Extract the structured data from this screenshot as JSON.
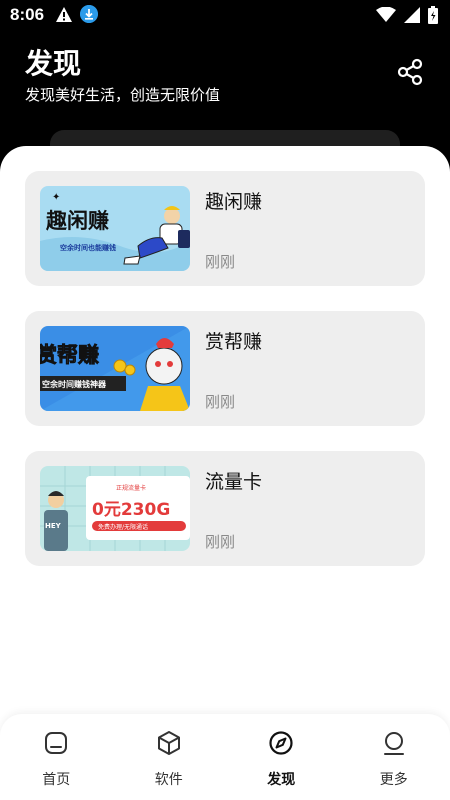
{
  "status_bar": {
    "time": "8:06",
    "icons": [
      "warning-icon",
      "download-icon",
      "wifi-icon",
      "cell-signal-icon",
      "battery-icon"
    ]
  },
  "header": {
    "title": "发现",
    "subtitle": "发现美好生活，创造无限价值",
    "share_icon": "share-icon"
  },
  "cards": [
    {
      "title": "趣闲赚",
      "time": "刚刚",
      "thumb": {
        "headline": "趣闲赚",
        "sub": "空余时间也能赚钱",
        "bg": "#a9dcf2"
      }
    },
    {
      "title": "赏帮赚",
      "time": "刚刚",
      "thumb": {
        "headline": "赏帮赚",
        "sub": "空余时间赚钱神器",
        "bg": "#3a8ee6"
      }
    },
    {
      "title": "流量卡",
      "time": "刚刚",
      "thumb": {
        "headline": "0元230G",
        "tag": "正规流量卡",
        "sub": "免费办理/无限通话",
        "bg": "#bfe7e6"
      }
    }
  ],
  "tabbar": {
    "active": 2,
    "tabs": [
      {
        "label": "首页",
        "icon": "home-icon"
      },
      {
        "label": "软件",
        "icon": "cube-icon"
      },
      {
        "label": "发现",
        "icon": "compass-icon"
      },
      {
        "label": "更多",
        "icon": "user-icon"
      }
    ]
  },
  "colors": {
    "header_bg": "#000000",
    "card_bg": "#eeeeee",
    "time_text": "#8a8a8a",
    "thumb_red": "#e33b3b"
  }
}
